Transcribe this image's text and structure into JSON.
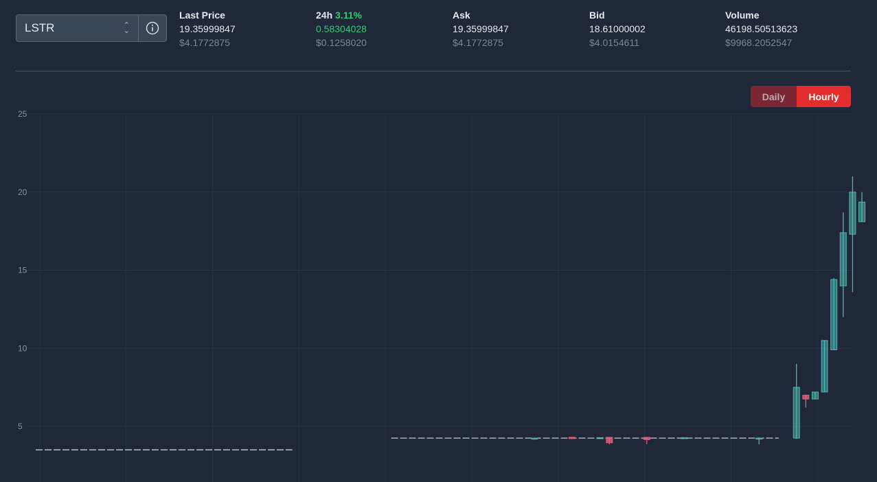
{
  "selector": {
    "value": "LSTR"
  },
  "stats": [
    {
      "label": "Last Price",
      "value": "19.35999847",
      "usd": "$4.1772875"
    },
    {
      "label": "24h",
      "pct": "3.11%",
      "value": "0.58304028",
      "usd": "$0.1258020"
    },
    {
      "label": "Ask",
      "value": "19.35999847",
      "usd": "$4.1772875"
    },
    {
      "label": "Bid",
      "value": "18.61000002",
      "usd": "$4.0154611"
    },
    {
      "label": "Volume",
      "value": "46198.50513623",
      "usd": "$9968.2052547"
    }
  ],
  "toggle": {
    "daily": "Daily",
    "hourly": "Hourly",
    "active": "hourly"
  },
  "colors": {
    "up": "#4db6b2",
    "down": "#e05a7a",
    "positive": "#2ecc71",
    "accent": "#e32d2d"
  },
  "chart_data": {
    "type": "candlestick",
    "ylim": [
      2.5,
      25
    ],
    "yticks": [
      5,
      10,
      15,
      20,
      25
    ],
    "grid": true,
    "flat_segments": [
      {
        "from": 0,
        "to": 27,
        "value": 3.5
      },
      {
        "from": 38,
        "to": 79,
        "value": 4.25
      }
    ],
    "candles": [
      {
        "i": 53,
        "o": 4.2,
        "h": 4.25,
        "l": 4.15,
        "c": 4.25
      },
      {
        "i": 57,
        "o": 4.3,
        "h": 4.3,
        "l": 4.2,
        "c": 4.22
      },
      {
        "i": 60,
        "o": 4.25,
        "h": 4.25,
        "l": 4.2,
        "c": 4.28
      },
      {
        "i": 61,
        "o": 4.3,
        "h": 4.3,
        "l": 3.85,
        "c": 3.95
      },
      {
        "i": 65,
        "o": 4.3,
        "h": 4.3,
        "l": 3.85,
        "c": 4.15
      },
      {
        "i": 69,
        "o": 4.22,
        "h": 4.25,
        "l": 4.2,
        "c": 4.28
      },
      {
        "i": 77,
        "o": 4.2,
        "h": 4.3,
        "l": 3.85,
        "c": 4.25
      },
      {
        "i": 81,
        "o": 4.25,
        "h": 9.0,
        "l": 4.2,
        "c": 7.5
      },
      {
        "i": 82,
        "o": 7.0,
        "h": 7.0,
        "l": 6.2,
        "c": 6.75
      },
      {
        "i": 83,
        "o": 6.75,
        "h": 7.2,
        "l": 6.75,
        "c": 7.2
      },
      {
        "i": 84,
        "o": 7.2,
        "h": 10.5,
        "l": 7.2,
        "c": 10.5
      },
      {
        "i": 85,
        "o": 9.9,
        "h": 14.5,
        "l": 9.9,
        "c": 14.4
      },
      {
        "i": 86,
        "o": 14.0,
        "h": 18.7,
        "l": 12.0,
        "c": 17.4
      },
      {
        "i": 87,
        "o": 17.3,
        "h": 21.0,
        "l": 13.6,
        "c": 20.0
      },
      {
        "i": 88,
        "o": 18.1,
        "h": 20.0,
        "l": 18.1,
        "c": 19.36
      }
    ]
  }
}
